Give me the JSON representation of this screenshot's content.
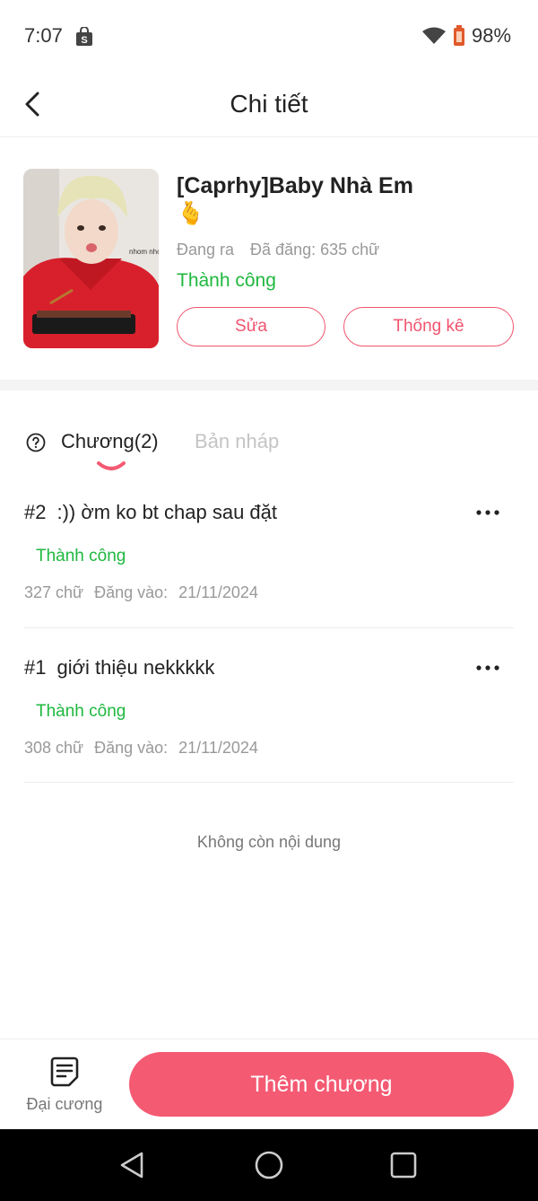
{
  "status_bar": {
    "time": "7:07",
    "battery": "98%"
  },
  "header": {
    "title": "Chi tiết"
  },
  "story": {
    "title": "[Caprhy]Baby Nhà Em",
    "emoji": "🫰",
    "state": "Đang ra",
    "posted": "Đã đăng: 635 chữ",
    "status": "Thành công",
    "edit_label": "Sửa",
    "stats_label": "Thống kê",
    "cover_text": "nhom nhom"
  },
  "tabs": {
    "chapters": "Chương(2)",
    "drafts": "Bản nháp"
  },
  "chapters": [
    {
      "number": "#2",
      "title": ":)) ờm ko bt chap sau đặt",
      "status": "Thành công",
      "words": "327 chữ",
      "posted_label": "Đăng vào:",
      "date": "21/11/2024"
    },
    {
      "number": "#1",
      "title": "giới thiệu nekkkkk",
      "status": "Thành công",
      "words": "308 chữ",
      "posted_label": "Đăng vào:",
      "date": "21/11/2024"
    }
  ],
  "empty_text": "Không còn nội dung",
  "bottom": {
    "outline_label": "Đại cương",
    "add_label": "Thêm chương"
  },
  "colors": {
    "accent": "#f45a72",
    "success": "#1fb83f"
  }
}
